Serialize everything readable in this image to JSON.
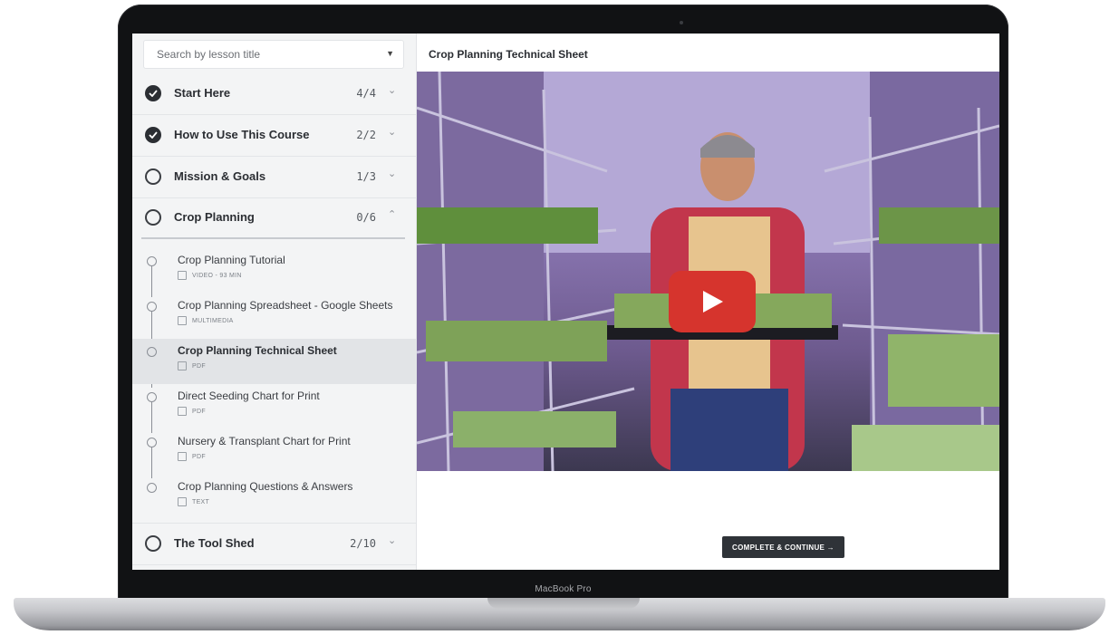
{
  "device": {
    "label": "MacBook Pro"
  },
  "sidebar": {
    "search": {
      "placeholder": "Search by lesson title",
      "caret": "▼"
    },
    "sections": [
      {
        "title": "Start Here",
        "count": "4/4",
        "state": "done",
        "chevron": "⌄"
      },
      {
        "title": "How to Use This Course",
        "count": "2/2",
        "state": "done",
        "chevron": "⌄"
      },
      {
        "title": "Mission & Goals",
        "count": "1/3",
        "state": "open",
        "chevron": "⌄"
      },
      {
        "title": "Crop Planning",
        "count": "0/6",
        "state": "open",
        "chevron": "⌃"
      },
      {
        "title": "The Tool Shed",
        "count": "2/10",
        "state": "open",
        "chevron": "⌄"
      }
    ],
    "lessons": [
      {
        "title": "Crop Planning Tutorial",
        "meta": "VIDEO - 93 MIN",
        "icon": "video-icon"
      },
      {
        "title": "Crop Planning Spreadsheet - Google Sheets",
        "meta": "MULTIMEDIA",
        "icon": "multimedia-icon"
      },
      {
        "title": "Crop Planning Technical Sheet",
        "meta": "PDF",
        "icon": "pdf-icon",
        "active": true
      },
      {
        "title": "Direct Seeding Chart for Print",
        "meta": "PDF",
        "icon": "pdf-icon"
      },
      {
        "title": "Nursery & Transplant Chart for Print",
        "meta": "PDF",
        "icon": "pdf-icon"
      },
      {
        "title": "Crop Planning Questions & Answers",
        "meta": "TEXT",
        "icon": "text-icon"
      }
    ]
  },
  "main": {
    "title": "Crop Planning Technical Sheet",
    "video": {
      "play_icon": "play-icon"
    },
    "complete_button": "COMPLETE & CONTINUE →"
  }
}
